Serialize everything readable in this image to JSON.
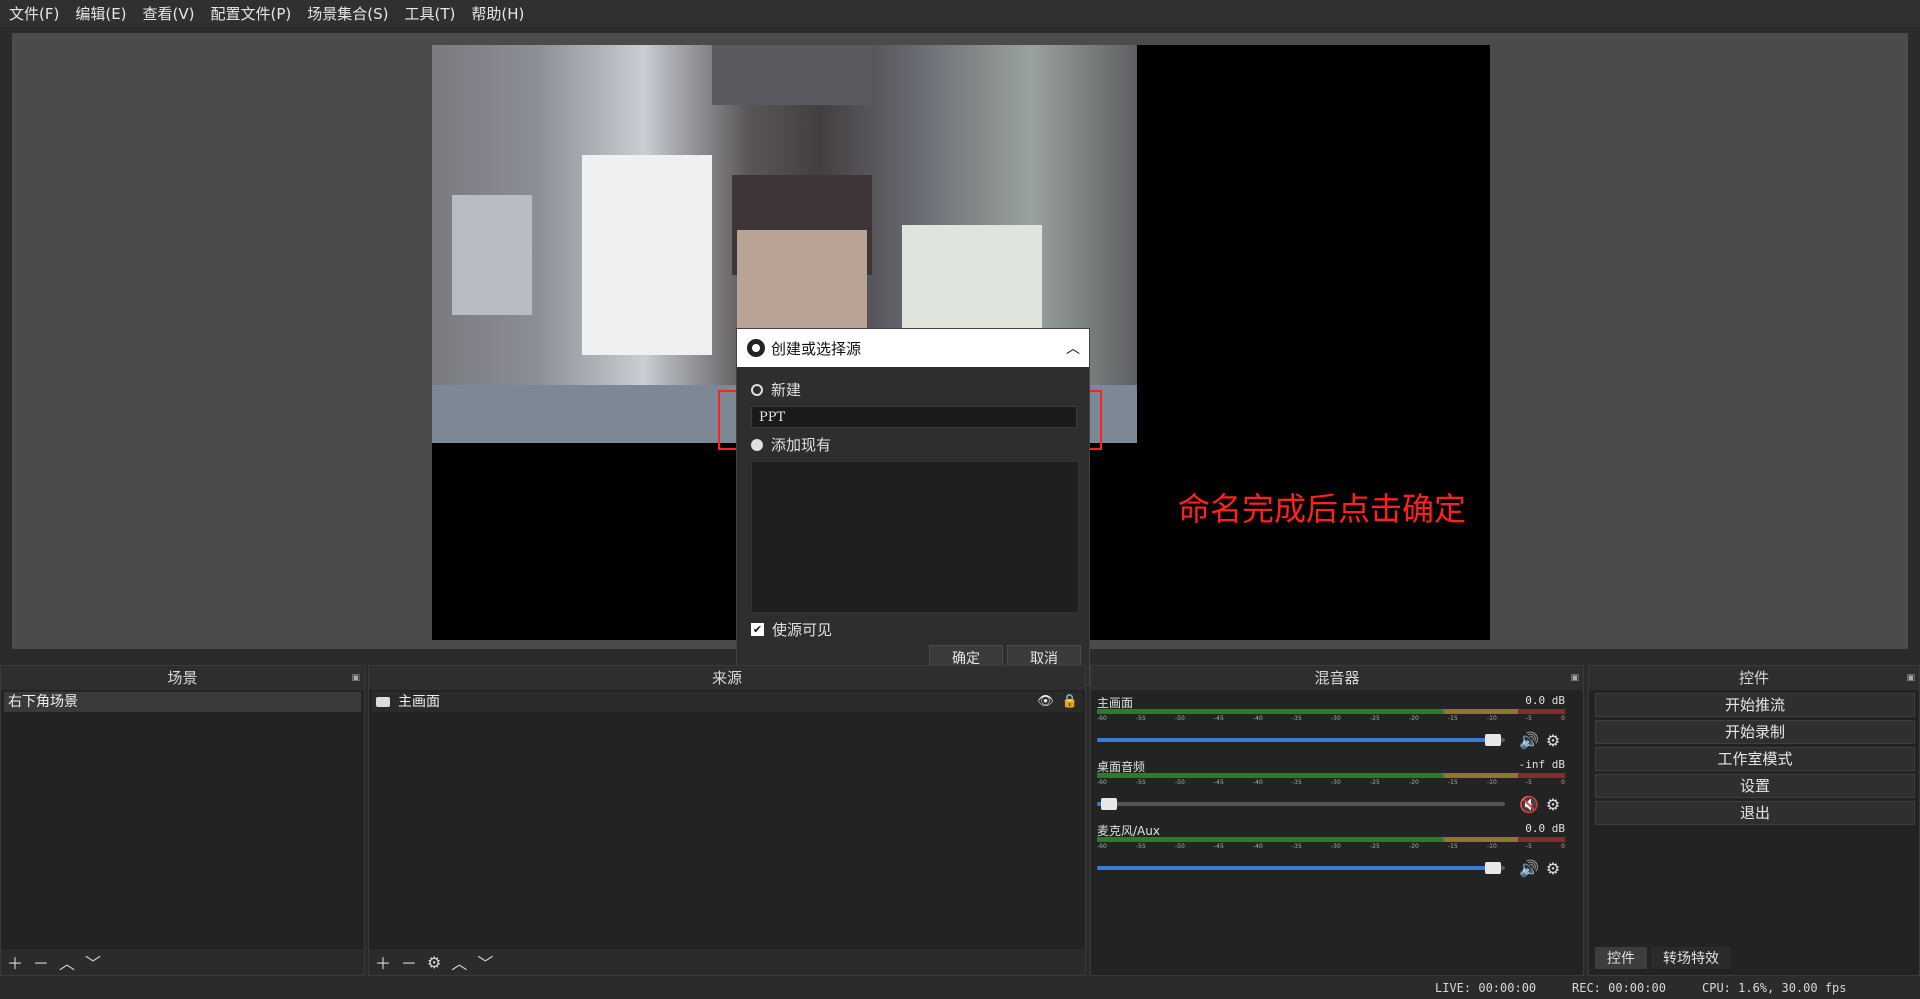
{
  "menu": [
    "文件(F)",
    "编辑(E)",
    "查看(V)",
    "配置文件(P)",
    "场景集合(S)",
    "工具(T)",
    "帮助(H)"
  ],
  "annotation": {
    "text": "命名完成后点击确定",
    "color": "#ff2020"
  },
  "dialog": {
    "title": "创建或选择源",
    "new_label": "新建",
    "name_value": "PPT",
    "existing_label": "添加现有",
    "visible_label": "使源可见",
    "ok_label": "确定",
    "cancel_label": "取消"
  },
  "docks": {
    "scenes": {
      "title": "场景",
      "items": [
        "右下角场景"
      ]
    },
    "sources": {
      "title": "来源",
      "items": [
        "主画面"
      ]
    },
    "mixer": {
      "title": "混音器",
      "channels": [
        {
          "name": "主画面",
          "db": "0.0 dB",
          "level": 0.97,
          "muted": false
        },
        {
          "name": "桌面音频",
          "db": "-inf dB",
          "level": 0.03,
          "muted": true
        },
        {
          "name": "麦克风/Aux",
          "db": "0.0 dB",
          "level": 0.97,
          "muted": false
        }
      ],
      "ticks": [
        "-60",
        "-55",
        "-50",
        "-45",
        "-40",
        "-35",
        "-30",
        "-25",
        "-20",
        "-15",
        "-10",
        "-5",
        "0"
      ]
    },
    "controls": {
      "title": "控件",
      "buttons": [
        "开始推流",
        "开始录制",
        "工作室模式",
        "设置",
        "退出"
      ],
      "tabs": [
        "控件",
        "转场特效"
      ]
    }
  },
  "status": {
    "live": "LIVE: 00:00:00",
    "rec": "REC: 00:00:00",
    "cpu": "CPU: 1.6%, 30.00 fps"
  },
  "colors": {
    "accent": "#3b7bd4",
    "mute": "#e02020"
  }
}
